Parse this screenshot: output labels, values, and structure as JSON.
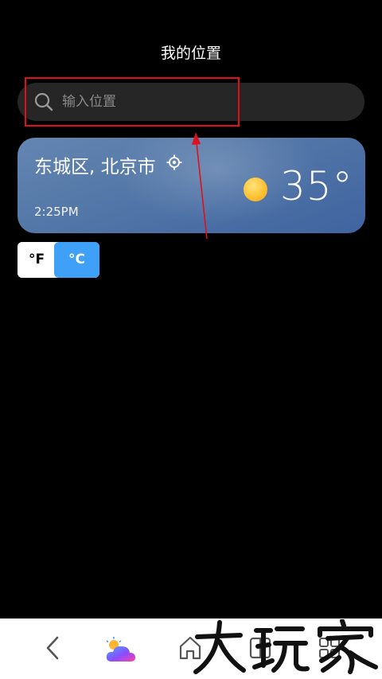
{
  "header": {
    "title": "我的位置"
  },
  "search": {
    "placeholder": "输入位置",
    "value": "",
    "icon": "search-icon"
  },
  "location_card": {
    "city": "东城区, 北京市",
    "time": "2:25PM",
    "temperature": "35°",
    "weather_icon": "sun-icon",
    "locate_icon": "location-target-icon",
    "colors": {
      "card_top": "#6486b2",
      "card_bottom": "#3f64a0",
      "sun": "#ffc233"
    }
  },
  "unit_toggle": {
    "fahrenheit_label": "°F",
    "celsius_label": "°C",
    "selected": "°C",
    "colors": {
      "selected_bg": "#3ea1f7",
      "unselected_bg": "#ffffff"
    }
  },
  "annotation": {
    "color": "#e0101a"
  },
  "bottom_nav": {
    "items": [
      {
        "name": "back",
        "icon": "chevron-left-icon"
      },
      {
        "name": "weather-app",
        "icon": "weather-app-icon"
      },
      {
        "name": "home",
        "icon": "home-icon"
      },
      {
        "name": "recents",
        "icon": "recents-icon"
      },
      {
        "name": "menu",
        "icon": "grid-icon"
      }
    ]
  },
  "watermark": {
    "text": "大玩家"
  }
}
